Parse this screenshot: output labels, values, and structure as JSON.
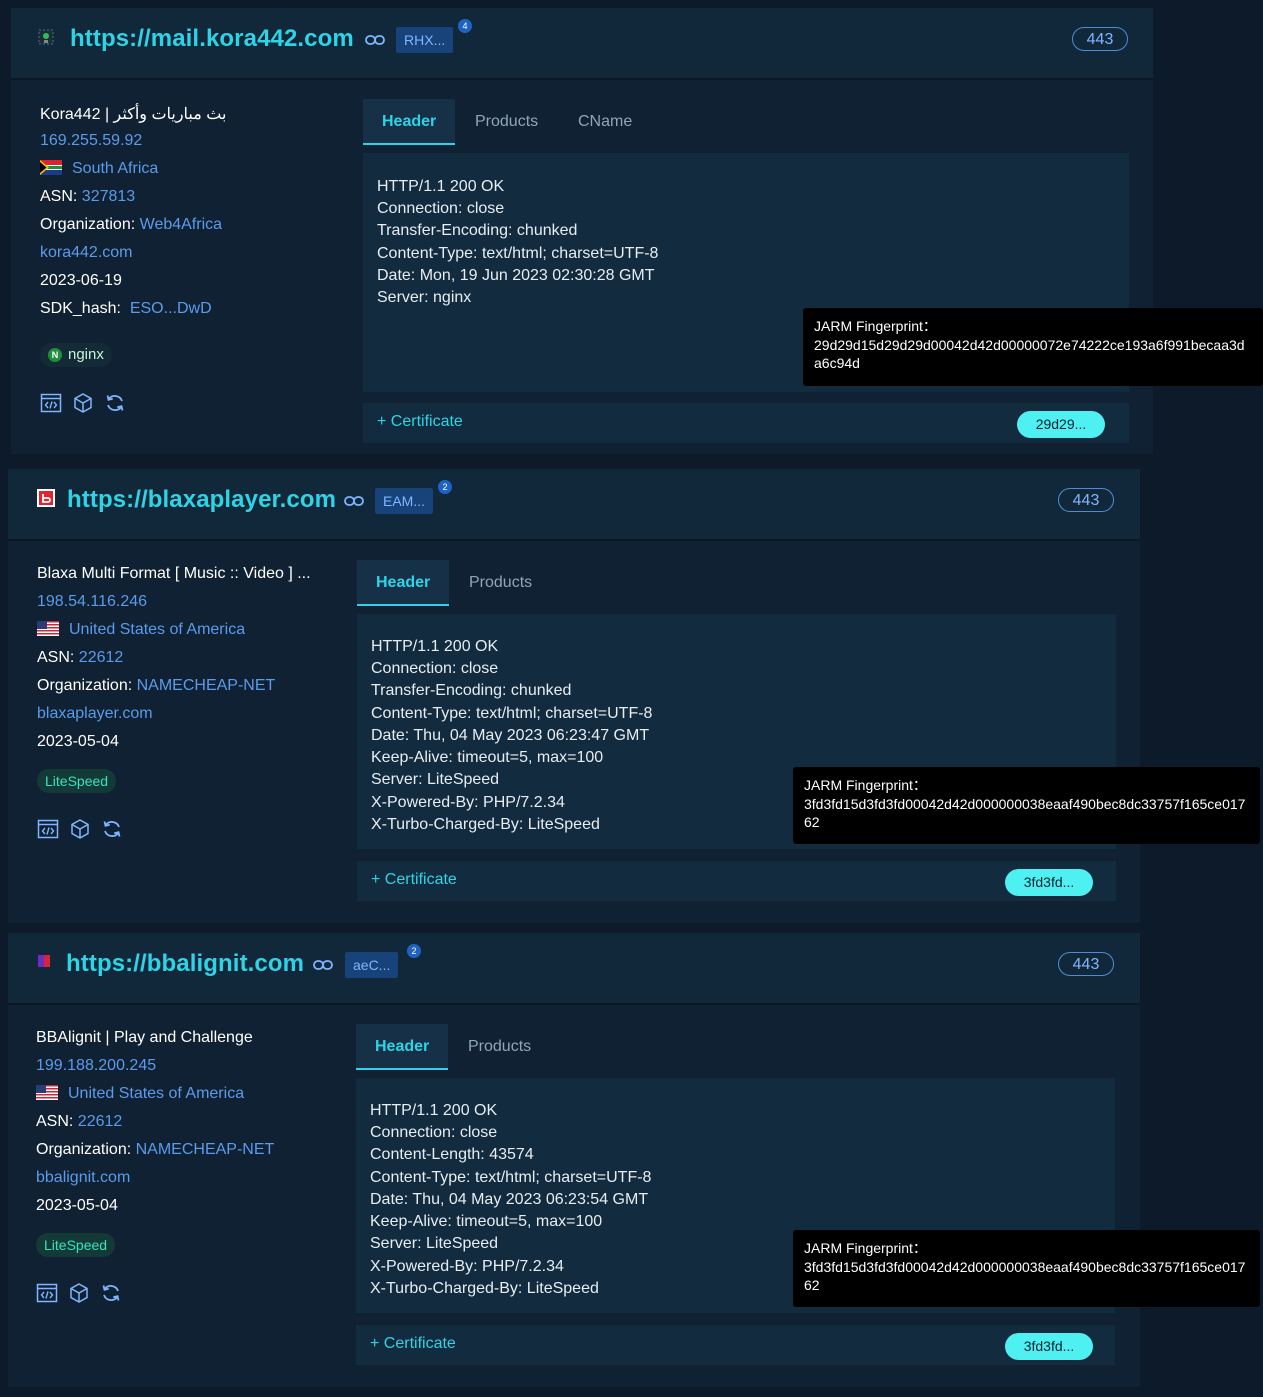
{
  "records": [
    {
      "url": "https://mail.kora442.com",
      "tag": "RHX...",
      "tag_count": "4",
      "port": "443",
      "title": "Kora442 | بث مباريات وأكثر",
      "ip": "169.255.59.92",
      "country": "South Africa",
      "asn_label": "ASN:",
      "asn": "327813",
      "org_label": "Organization:",
      "org": "Web4Africa",
      "domain": "kora442.com",
      "date": "2023-06-19",
      "sdk_label": "SDK_hash:",
      "sdk": "ESO...DwD",
      "product": "nginx",
      "tabs": [
        "Header",
        "Products",
        "CName"
      ],
      "header_lines": [
        "HTTP/1.1 200 OK",
        "Connection: close",
        "Transfer-Encoding: chunked",
        "Content-Type: text/html; charset=UTF-8",
        "Date: Mon, 19 Jun 2023 02:30:28 GMT",
        "Server: nginx"
      ],
      "certificate": "+ Certificate",
      "jarm_short": "29d29...",
      "jarm_label": "JARM Fingerprint：",
      "jarm_full": "29d29d15d29d29d00042d42d00000072e74222ce193a6f991becaa3da6c94d"
    },
    {
      "url": "https://blaxaplayer.com",
      "tag": "EAM...",
      "tag_count": "2",
      "port": "443",
      "title": "Blaxa Multi Format [ Music :: Video ] ...",
      "ip": "198.54.116.246",
      "country": "United States of America",
      "asn_label": "ASN:",
      "asn": "22612",
      "org_label": "Organization:",
      "org": "NAMECHEAP-NET",
      "domain": "blaxaplayer.com",
      "date": "2023-05-04",
      "product": "LiteSpeed",
      "tabs": [
        "Header",
        "Products"
      ],
      "header_lines": [
        "HTTP/1.1 200 OK",
        "Connection: close",
        "Transfer-Encoding: chunked",
        "Content-Type: text/html; charset=UTF-8",
        "Date: Thu, 04 May 2023 06:23:47 GMT",
        "Keep-Alive: timeout=5, max=100",
        "Server: LiteSpeed",
        "X-Powered-By: PHP/7.2.34",
        "X-Turbo-Charged-By: LiteSpeed"
      ],
      "certificate": "+ Certificate",
      "jarm_short": "3fd3fd...",
      "jarm_label": "JARM Fingerprint：",
      "jarm_full": "3fd3fd15d3fd3fd00042d42d000000038eaaf490bec8dc33757f165ce01762"
    },
    {
      "url": "https://bbalignit.com",
      "tag": "aeC...",
      "tag_count": "2",
      "port": "443",
      "title": "BBAlignit | Play and Challenge",
      "ip": "199.188.200.245",
      "country": "United States of America",
      "asn_label": "ASN:",
      "asn": "22612",
      "org_label": "Organization:",
      "org": "NAMECHEAP-NET",
      "domain": "bbalignit.com",
      "date": "2023-05-04",
      "product": "LiteSpeed",
      "tabs": [
        "Header",
        "Products"
      ],
      "header_lines": [
        "HTTP/1.1 200 OK",
        "Connection: close",
        "Content-Length: 43574",
        "Content-Type: text/html; charset=UTF-8",
        "Date: Thu, 04 May 2023 06:23:54 GMT",
        "Keep-Alive: timeout=5, max=100",
        "Server: LiteSpeed",
        "X-Powered-By: PHP/7.2.34",
        "X-Turbo-Charged-By: LiteSpeed"
      ],
      "certificate": "+ Certificate",
      "jarm_short": "3fd3fd...",
      "jarm_label": "JARM Fingerprint：",
      "jarm_full": "3fd3fd15d3fd3fd00042d42d000000038eaaf490bec8dc33757f165ce01762"
    }
  ],
  "icons": {
    "favicons": [
      "kora-favicon-icon",
      "blaxa-favicon-icon",
      "bbalignit-favicon-icon"
    ],
    "actions": [
      "code-icon",
      "cube-icon",
      "refresh-icon"
    ],
    "link": "link-icon"
  },
  "colors": {
    "background": "#0d1a2a",
    "url": "#2ed3e6",
    "link": "#5b9bea",
    "jarm_pill": "#4ff0f2",
    "badge_text": "#37e2c0"
  }
}
